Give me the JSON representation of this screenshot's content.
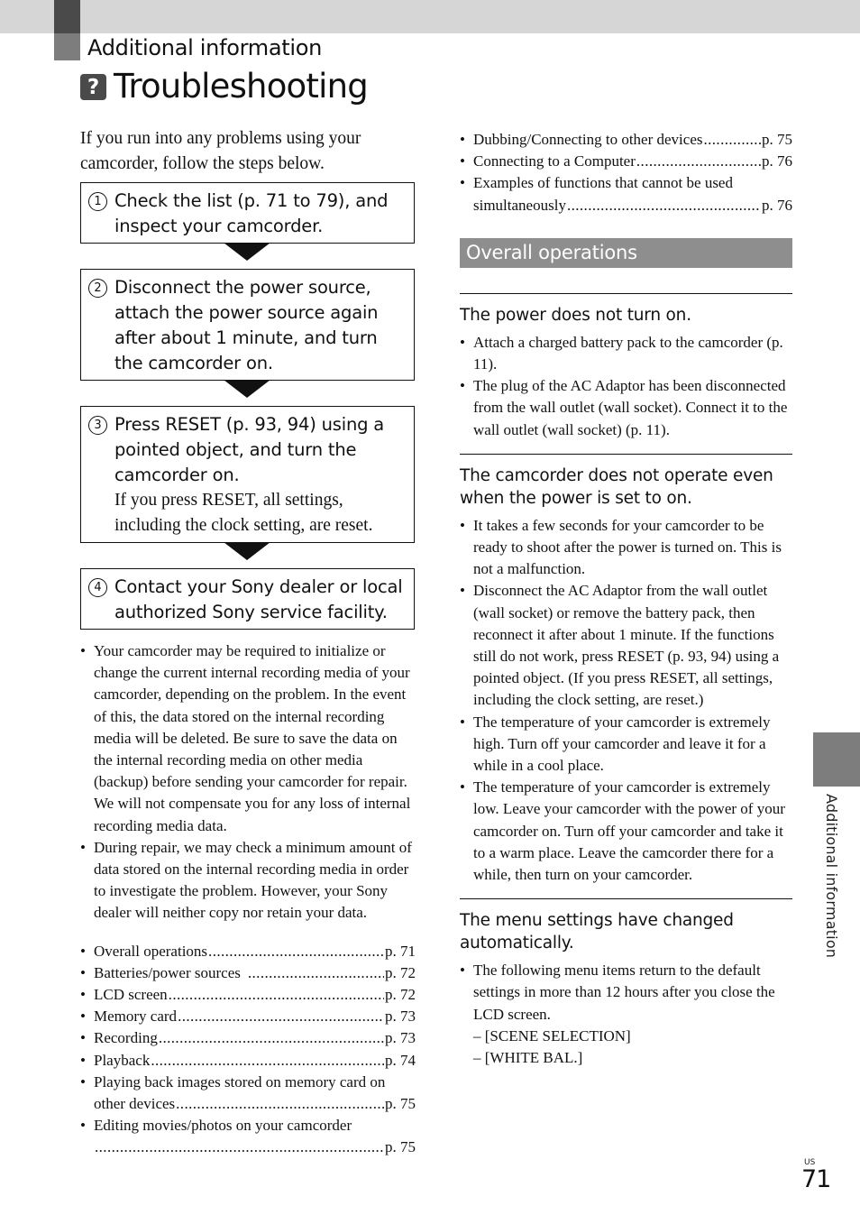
{
  "header": {
    "section": "Additional information",
    "title_icon": "question-mark-icon",
    "title_icon_glyph": "?",
    "title": "Troubleshooting"
  },
  "intro": "If you run into any problems using your camcorder, follow the steps below.",
  "steps": [
    {
      "num": "1",
      "text": "Check the list (p. 71 to 79), and inspect your camcorder.",
      "note": ""
    },
    {
      "num": "2",
      "text": "Disconnect the power source, attach the power source again after about 1 minute, and turn the camcorder on.",
      "note": ""
    },
    {
      "num": "3",
      "text": "Press RESET (p. 93, 94) using a pointed object, and turn the camcorder on.",
      "note": "If you press RESET, all settings, including the clock setting, are reset."
    },
    {
      "num": "4",
      "text": "Contact your Sony dealer or local authorized Sony service facility.",
      "note": ""
    }
  ],
  "notes": [
    "Your camcorder may be required to initialize or change the current internal recording media of your camcorder, depending on the problem. In the event of this, the data stored on the internal recording media will be deleted. Be sure to save the data on the internal recording media on other media (backup) before sending your camcorder for repair. We will not compensate you for any loss of internal recording media data.",
    "During repair, we may check a minimum amount of data stored on the internal recording media in order to investigate the problem. However, your Sony dealer will neither copy nor retain your data."
  ],
  "toc": [
    {
      "label": "Overall operations",
      "page": "p. 71"
    },
    {
      "label": "Batteries/power sources",
      "page": "p. 72"
    },
    {
      "label": "LCD screen",
      "page": "p. 72"
    },
    {
      "label": "Memory card",
      "page": "p. 73"
    },
    {
      "label": "Recording",
      "page": "p. 73"
    },
    {
      "label": "Playback",
      "page": "p. 74"
    },
    {
      "label": "Playing back images stored on memory card on",
      "label2": "other devices",
      "page": "p. 75"
    },
    {
      "label": "Editing movies/photos on your camcorder",
      "label2": "",
      "page": "p. 75"
    },
    {
      "label": "Dubbing/Connecting to other devices",
      "page": "p. 75"
    },
    {
      "label": "Connecting to a Computer",
      "page": "p. 76"
    },
    {
      "label": "Examples of functions that cannot be used",
      "label2": "simultaneously",
      "page": "p. 76"
    }
  ],
  "section": {
    "title": "Overall operations",
    "topics": [
      {
        "title": "The power does not turn on.",
        "bullets": [
          "Attach a charged battery pack to the camcorder (p. 11).",
          "The plug of the AC Adaptor has been disconnected from the wall outlet (wall socket). Connect it to the wall outlet (wall socket) (p. 11)."
        ]
      },
      {
        "title": "The camcorder does not operate even when the power is set to on.",
        "bullets": [
          "It takes a few seconds for your camcorder to be ready to shoot after the power is turned on. This is not a malfunction.",
          "Disconnect the AC Adaptor from the wall outlet (wall socket) or remove the battery pack, then reconnect it after about 1 minute. If the functions still do not work, press RESET (p. 93, 94) using a pointed object. (If you press RESET, all settings, including the clock setting, are reset.)",
          "The temperature of your camcorder is extremely high. Turn off your camcorder and leave it for a while in a cool place.",
          "The temperature of your camcorder is extremely low. Leave your camcorder with the power of your camcorder on. Turn off your camcorder and take it to a warm place. Leave the camcorder there for a while, then turn on your camcorder."
        ]
      },
      {
        "title": "The menu settings have changed automatically.",
        "bullets": [
          "The following menu items return to the default settings in more than 12 hours after you close the LCD screen."
        ],
        "sub_items": [
          "– [SCENE SELECTION]",
          "– [WHITE BAL.]"
        ]
      }
    ]
  },
  "side_tab": "Additional information",
  "footer": {
    "lang": "US",
    "page_number": "71"
  }
}
